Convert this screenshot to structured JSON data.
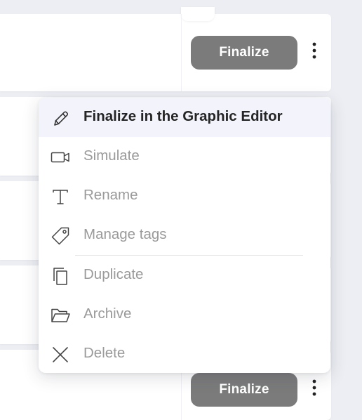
{
  "rows": {
    "finalize_label": "Finalize"
  },
  "menu": {
    "items": [
      {
        "label": "Finalize in the Graphic Editor",
        "icon": "pencil-icon"
      },
      {
        "label": "Simulate",
        "icon": "video-camera-icon"
      },
      {
        "label": "Rename",
        "icon": "text-t-icon"
      },
      {
        "label": "Manage tags",
        "icon": "tag-icon"
      },
      {
        "label": "Duplicate",
        "icon": "duplicate-icon"
      },
      {
        "label": "Archive",
        "icon": "folder-open-icon"
      },
      {
        "label": "Delete",
        "icon": "close-icon"
      }
    ]
  },
  "colors": {
    "button_bg": "#7b7b7b",
    "highlight_bg": "#f3f3fb",
    "primary_text": "#252525",
    "muted_text": "#9a9a9a",
    "page_bg": "#eceef3"
  }
}
